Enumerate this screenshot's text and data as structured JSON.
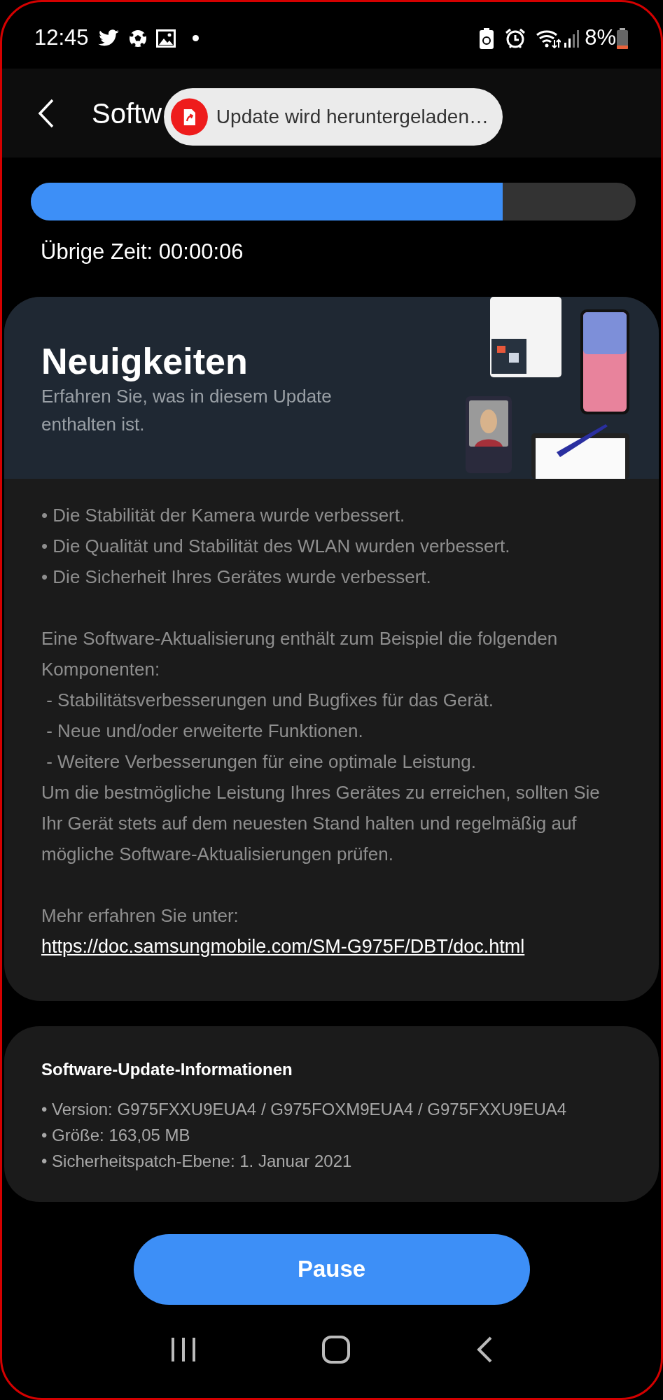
{
  "status_bar": {
    "time": "12:45",
    "battery": "8%"
  },
  "app_bar": {
    "title": "Softw"
  },
  "toast": {
    "text": "Update wird heruntergeladen…"
  },
  "progress": {
    "level": 0.78,
    "remaining": "Übrige Zeit: 00:00:06"
  },
  "whats_new": {
    "title": "Neuigkeiten",
    "subtitle": "Erfahren Sie, was in diesem Update enthalten ist.",
    "blocks": [
      [
        "• Die Stabilität der Kamera wurde verbessert.",
        "• Die Qualität und Stabilität des WLAN wurden verbessert.",
        "• Die Sicherheit Ihres Gerätes wurde verbessert."
      ],
      [
        "Eine Software-Aktualisierung enthält zum Beispiel die folgenden Komponenten:",
        " - Stabilitätsverbesserungen und Bugfixes für das Gerät.",
        " - Neue und/oder erweiterte Funktionen.",
        " - Weitere Verbesserungen für eine optimale Leistung.",
        "Um die bestmögliche Leistung Ihres Gerätes zu erreichen, sollten Sie Ihr Gerät stets auf dem neuesten Stand halten und regelmäßig auf mögliche Software-Aktualisierungen prüfen."
      ],
      [
        "Mehr erfahren Sie unter:"
      ]
    ],
    "link": "https://doc.samsungmobile.com/SM-G975F/DBT/doc.html"
  },
  "info": {
    "title": "Software-Update-Informationen",
    "items": [
      "• Version: G975FXXU9EUA4 / G975FOXM9EUA4 / G975FXXU9EUA4",
      "• Größe: 163,05 MB",
      "• Sicherheitspatch-Ebene: 1. Januar 2021"
    ]
  },
  "pause_button": "Pause"
}
